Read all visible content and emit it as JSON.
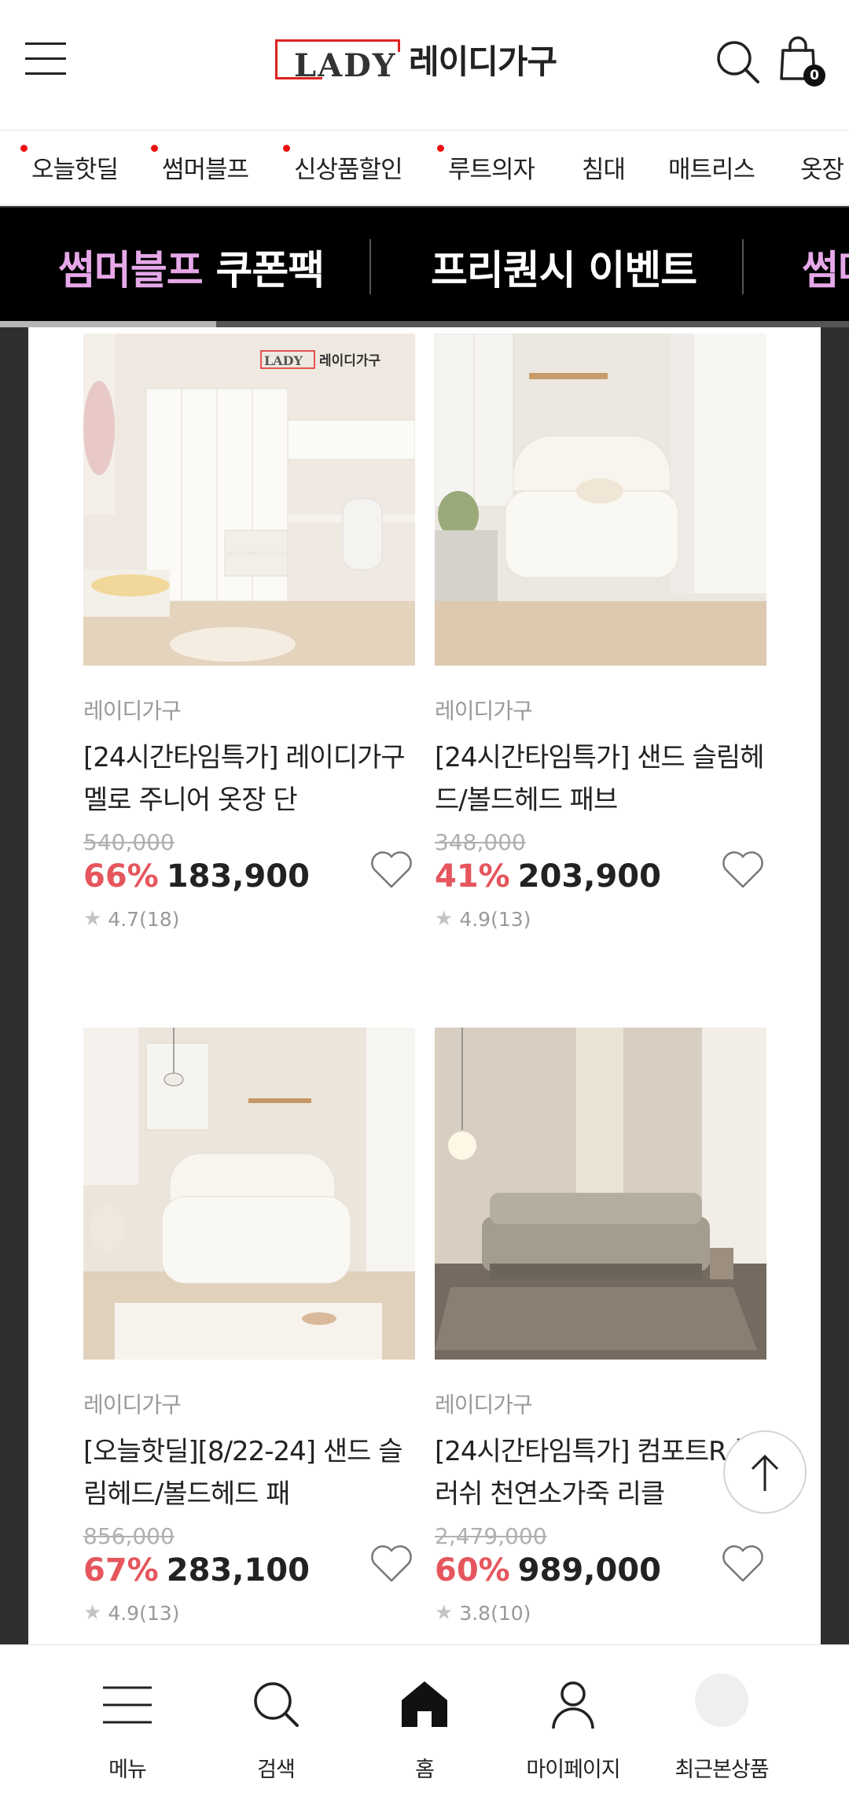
{
  "header": {
    "logo_en": "LADY",
    "logo_ko": "레이디가구",
    "cart_count": "0"
  },
  "categories": [
    {
      "label": "오늘핫딜",
      "dot": true
    },
    {
      "label": "썸머블프",
      "dot": true
    },
    {
      "label": "신상품할인",
      "dot": true
    },
    {
      "label": "루트의자",
      "dot": true
    },
    {
      "label": "침대",
      "dot": false
    },
    {
      "label": "매트리스",
      "dot": false
    },
    {
      "label": "옷장",
      "dot": false
    }
  ],
  "events": [
    {
      "highlight": "썸머블프",
      "rest": " 쿠폰팩"
    },
    {
      "highlight": "",
      "rest": "프리퀀시 이벤트"
    },
    {
      "highlight": "썸머블프",
      "rest": ""
    }
  ],
  "event_progress": 0.255,
  "products": [
    {
      "brand": "레이디가구",
      "name": "[24시간타임특가] 레이디가구 멜로 주니어 옷장 단",
      "original_price": "540,000",
      "discount": "66%",
      "price": "183,900",
      "rating": "4.7(18)"
    },
    {
      "brand": "레이디가구",
      "name": "[24시간타임특가] 샌드 슬림헤드/볼드헤드 패브",
      "original_price": "348,000",
      "discount": "41%",
      "price": "203,900",
      "rating": "4.9(13)"
    },
    {
      "brand": "레이디가구",
      "name": "[오늘핫딜][8/22-24] 샌드 슬림헤드/볼드헤드 패",
      "original_price": "856,000",
      "discount": "67%",
      "price": "283,100",
      "rating": "4.9(13)"
    },
    {
      "brand": "레이디가구",
      "name": "[24시간타임특가] 컴포트R 플러쉬 천연소가죽 리클",
      "original_price": "2,479,000",
      "discount": "60%",
      "price": "989,000",
      "rating": "3.8(10)"
    }
  ],
  "bottom_nav": {
    "menu": "메뉴",
    "search": "검색",
    "home": "홈",
    "mypage": "마이페이지",
    "recent": "최근본상품"
  },
  "icons": {
    "menu": "hamburger-icon",
    "search": "search-icon",
    "cart": "shopping-bag-icon",
    "wishlist": "heart-icon",
    "top": "arrow-up-icon",
    "home": "home-icon",
    "mypage": "person-icon"
  },
  "colors": {
    "accent_red": "#e5565d",
    "event_pink": "#e6a8e8",
    "logo_red": "#dd2222"
  }
}
